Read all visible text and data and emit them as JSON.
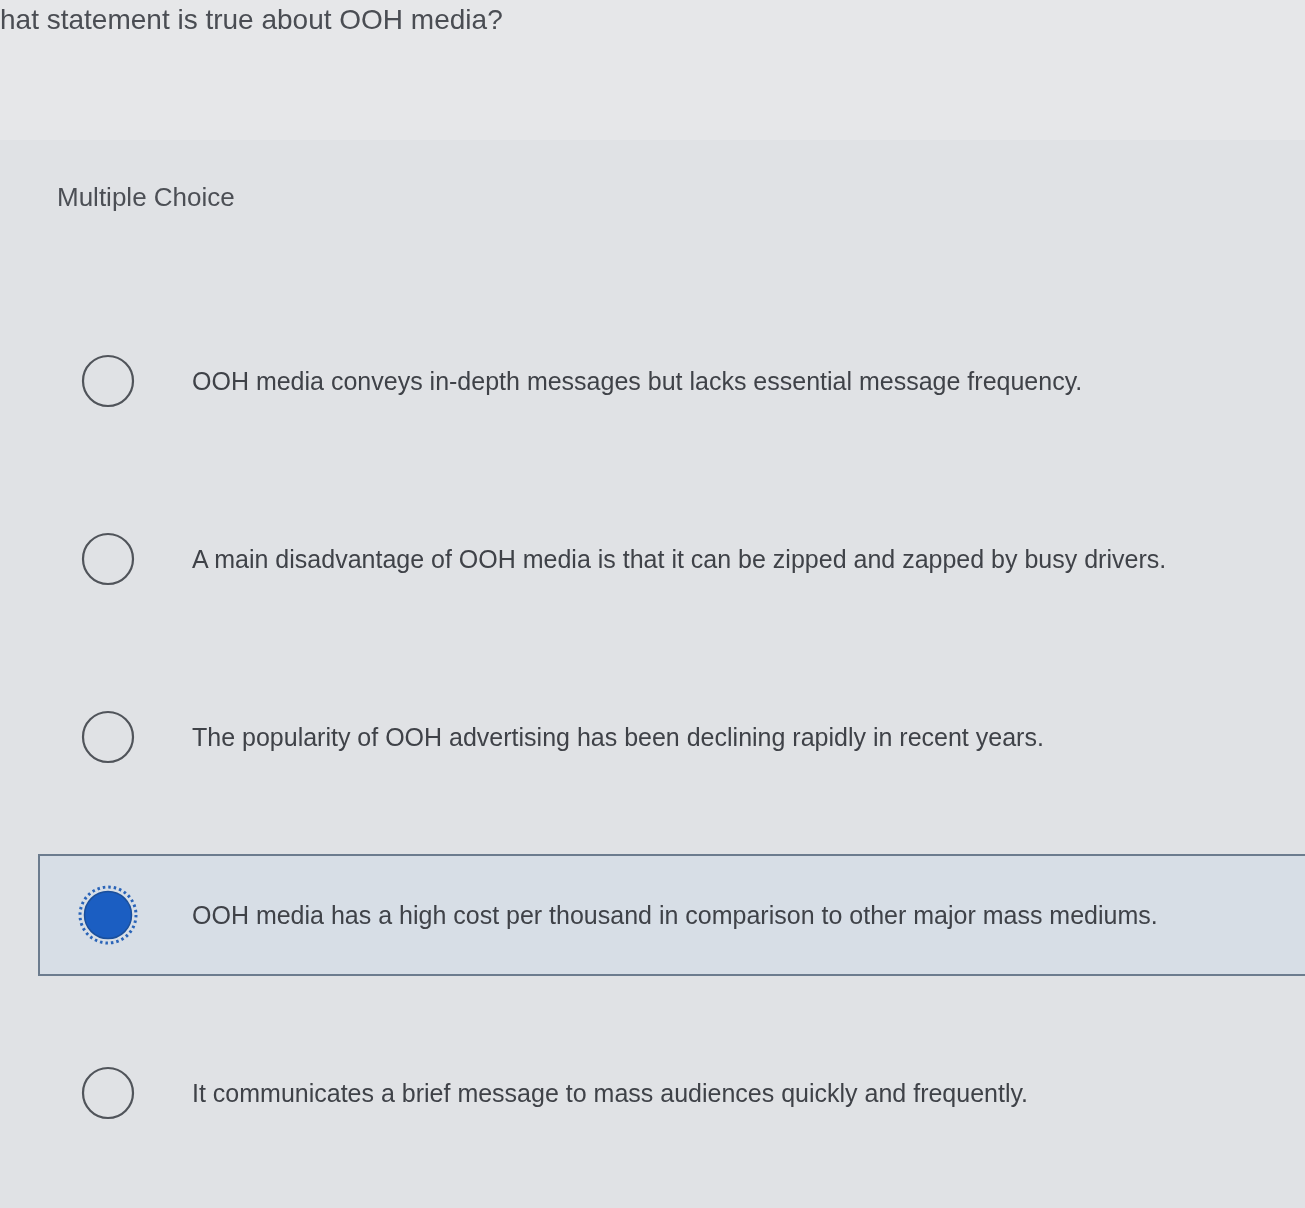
{
  "question": {
    "text": "hat statement is true about OOH media?"
  },
  "panel": {
    "type_label": "Multiple Choice",
    "options": [
      {
        "text": "OOH media conveys in-depth messages but lacks essential message frequency.",
        "selected": false
      },
      {
        "text": "A main disadvantage of OOH media is that it can be zipped and zapped by busy drivers.",
        "selected": false
      },
      {
        "text": "The popularity of OOH advertising has been declining rapidly in recent years.",
        "selected": false
      },
      {
        "text": "OOH media has a high cost per thousand in comparison to other major mass mediums.",
        "selected": true
      },
      {
        "text": "It communicates a brief message to mass audiences quickly and frequently.",
        "selected": false
      }
    ]
  }
}
